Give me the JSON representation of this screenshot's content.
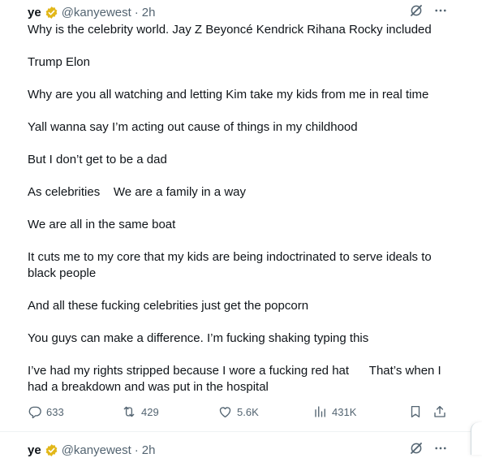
{
  "tweet": {
    "name": "ye",
    "handle": "@kanyewest",
    "time": "2h",
    "paragraphs": [
      "Why is the celebrity world. Jay Z Beyoncé Kendrick Rihana Rocky included",
      "Trump Elon",
      "Why are you all watching and letting Kim take my kids from me in real time",
      "Yall wanna say I’m acting out cause of things in my childhood",
      "But I don’t get to be a dad",
      "As celebrities    We are a family in a way",
      "We are all in the same boat",
      "It cuts me to my core that my kids are being indoctrinated to serve ideals to black people",
      "And all these fucking celebrities just get the popcorn",
      "You guys can make a difference. I’m fucking shaking typing this",
      "I’ve had my rights stripped because I wore a fucking red hat      That’s when I had a breakdown and was put in the hospital"
    ],
    "stats": {
      "replies": "633",
      "reposts": "429",
      "likes": "5.6K",
      "views": "431K"
    }
  },
  "next_tweet": {
    "name": "ye",
    "handle": "@kanyewest",
    "time": "2h"
  },
  "colors": {
    "text": "#0f1419",
    "secondary": "#536471",
    "verified_gold": "#e2b719",
    "divider": "#eff3f4"
  },
  "icons": [
    "verified-badge-icon",
    "grok-icon",
    "more-icon",
    "reply-icon",
    "repost-icon",
    "like-icon",
    "views-icon",
    "bookmark-icon",
    "share-icon"
  ]
}
